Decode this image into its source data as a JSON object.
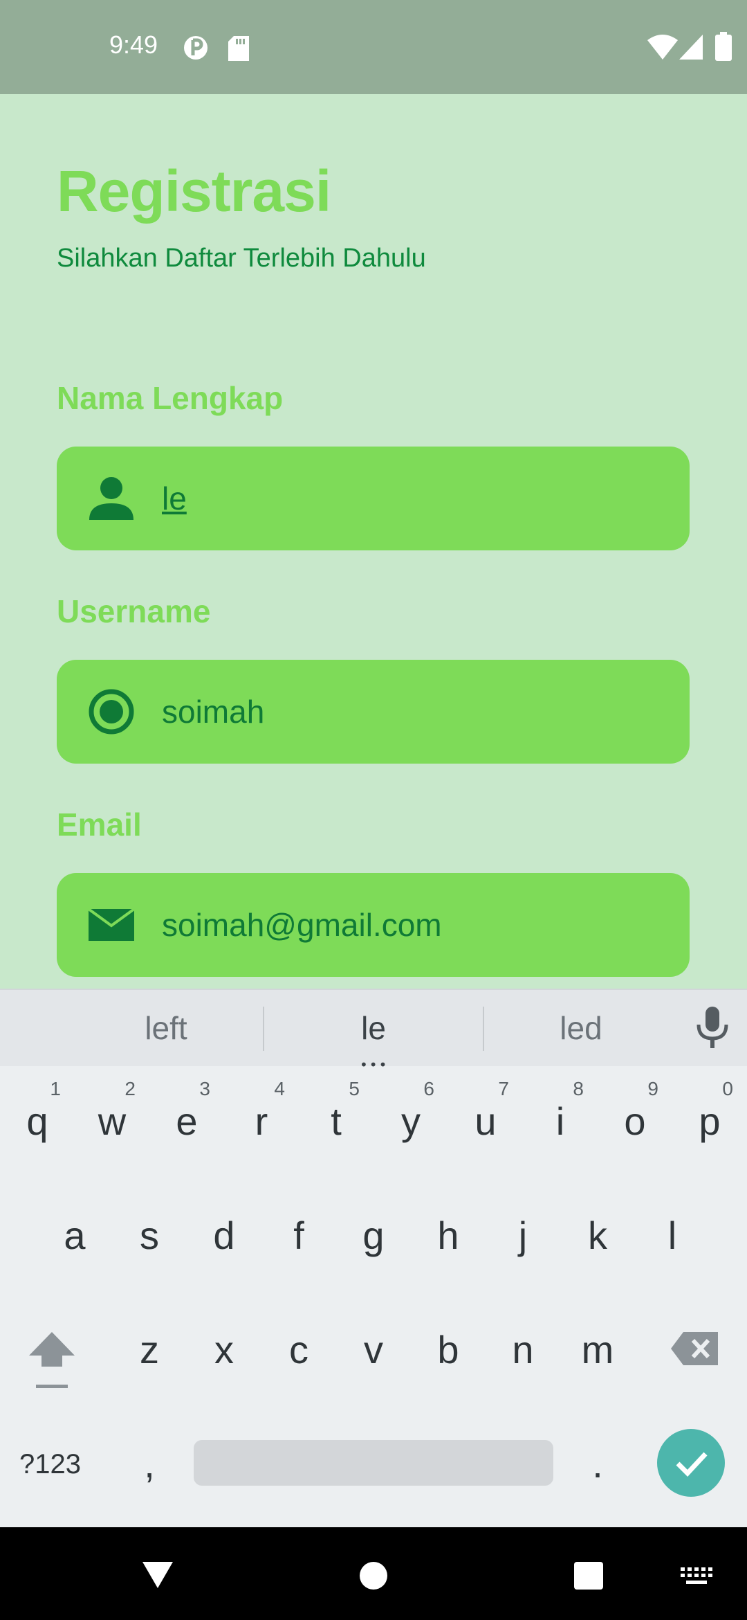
{
  "status_bar": {
    "time": "9:49",
    "left_icons": [
      "data-saver-icon",
      "sd-card-icon"
    ],
    "right_icons": [
      "wifi-icon",
      "signal-icon",
      "battery-icon"
    ]
  },
  "page": {
    "title": "Registrasi",
    "subtitle": "Silahkan Daftar Terlebih Dahulu"
  },
  "form": {
    "fields": [
      {
        "label": "Nama Lengkap",
        "value": "le",
        "icon": "person-icon"
      },
      {
        "label": "Username",
        "value": "soimah",
        "icon": "radio-button-icon"
      },
      {
        "label": "Email",
        "value": "soimah@gmail.com",
        "icon": "mail-icon"
      }
    ]
  },
  "keyboard": {
    "suggestions": [
      "left",
      "le",
      "led"
    ],
    "row1": [
      {
        "key": "q",
        "num": "1"
      },
      {
        "key": "w",
        "num": "2"
      },
      {
        "key": "e",
        "num": "3"
      },
      {
        "key": "r",
        "num": "4"
      },
      {
        "key": "t",
        "num": "5"
      },
      {
        "key": "y",
        "num": "6"
      },
      {
        "key": "u",
        "num": "7"
      },
      {
        "key": "i",
        "num": "8"
      },
      {
        "key": "o",
        "num": "9"
      },
      {
        "key": "p",
        "num": "0"
      }
    ],
    "row2": [
      "a",
      "s",
      "d",
      "f",
      "g",
      "h",
      "j",
      "k",
      "l"
    ],
    "row3": [
      "z",
      "x",
      "c",
      "v",
      "b",
      "n",
      "m"
    ],
    "symbols_label": "?123",
    "comma": ",",
    "period": "."
  },
  "colors": {
    "background": "#c8e8cb",
    "accent_green": "#7edb58",
    "dark_green": "#0f7a36",
    "enter_key": "#4db6ac"
  }
}
